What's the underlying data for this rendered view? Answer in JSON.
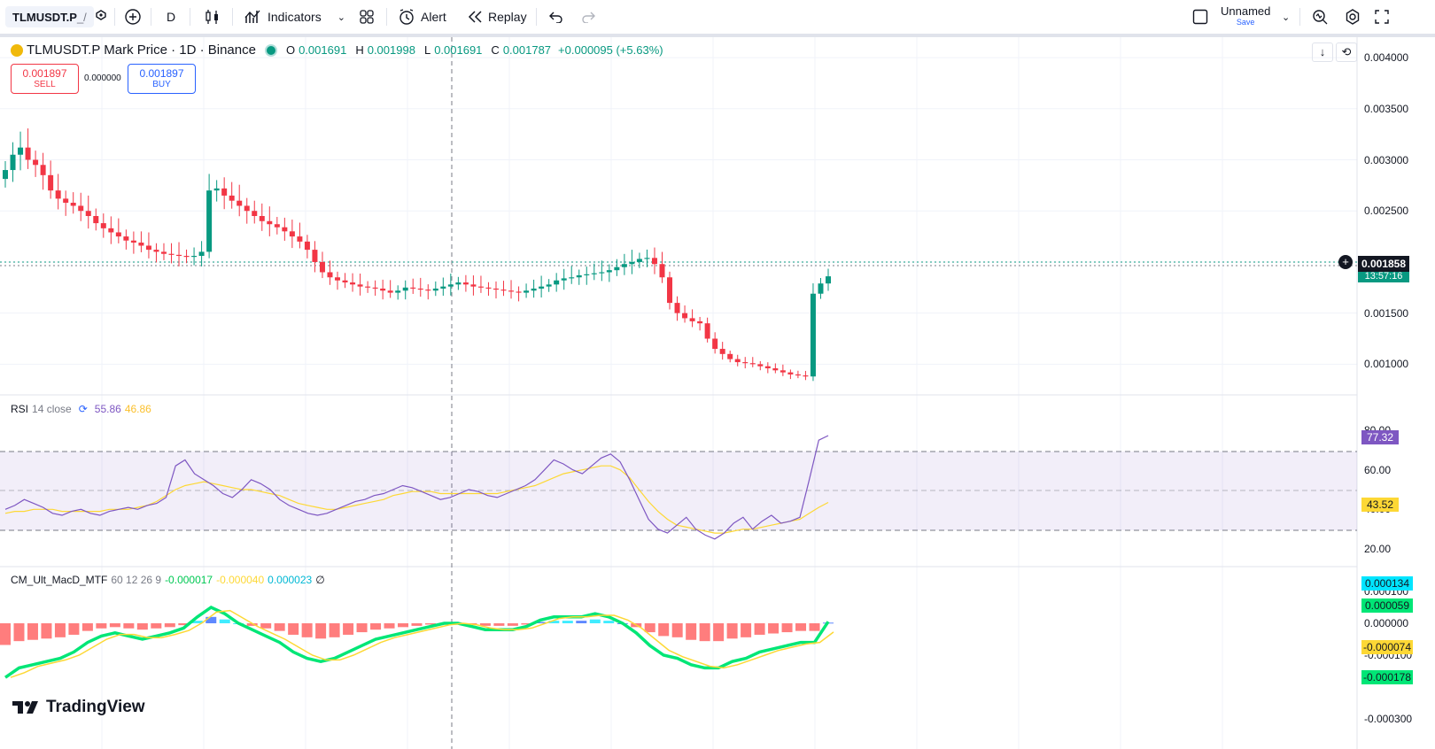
{
  "toolbar": {
    "symbol": "TLMUSDT.P",
    "interval": "D",
    "indicators_label": "Indicators",
    "alert_label": "Alert",
    "replay_label": "Replay",
    "layout_name": "Unnamed",
    "save_label": "Save"
  },
  "legend": {
    "title": "TLMUSDT.P Mark Price · 1D · Binance",
    "o_label": "O",
    "o_value": "0.001691",
    "h_label": "H",
    "h_value": "0.001998",
    "l_label": "L",
    "l_value": "0.001691",
    "c_label": "C",
    "c_value": "0.001787",
    "change": "+0.000095 (+5.63%)"
  },
  "trade": {
    "sell_price": "0.001897",
    "sell_label": "SELL",
    "spread": "0.000000",
    "buy_price": "0.001897",
    "buy_label": "BUY"
  },
  "price_axis": {
    "ticks": [
      "0.004000",
      "0.003500",
      "0.003000",
      "0.002500",
      "0.002000",
      "0.001500",
      "0.001000"
    ],
    "current_price": "0.001858",
    "countdown": "13:57:16"
  },
  "rsi": {
    "label": "RSI",
    "params": "14 close",
    "value": "55.86",
    "ma_value": "46.86",
    "ticks": [
      "80.00",
      "60.00",
      "40.00",
      "20.00"
    ],
    "current_pill": "77.32",
    "ma_pill": "43.52"
  },
  "macd": {
    "label": "CM_Ult_MacD_MTF",
    "params": "60 12 26 9",
    "v1": "-0.000017",
    "v2": "-0.000040",
    "v3": "0.000023",
    "v4": "∅",
    "ticks": [
      "0.000100",
      "0.000000",
      "-0.000100",
      "-0.000300"
    ],
    "pill_hist": "0.000134",
    "pill_signal": "0.000059",
    "pill_neg1": "-0.000074",
    "pill_neg2": "-0.000178"
  },
  "branding": "TradingView",
  "colors": {
    "up": "#089981",
    "down": "#f23645",
    "rsi": "#7e57c2",
    "rsi_ma": "#fdd835",
    "macd_up": "#00e676",
    "macd_down": "#ff5252",
    "hist_blue": "#2962ff",
    "hist_cyan": "#00e5ff"
  },
  "chart_data": {
    "type": "candlestick",
    "interval": "1D",
    "price_ylim": [
      0.0007,
      0.0042
    ],
    "closes": [
      0.0029,
      0.00305,
      0.00312,
      0.003,
      0.00295,
      0.00285,
      0.0027,
      0.00262,
      0.00258,
      0.00255,
      0.0025,
      0.00245,
      0.00238,
      0.00233,
      0.00229,
      0.00225,
      0.00221,
      0.00219,
      0.00216,
      0.00212,
      0.0021,
      0.00208,
      0.00207,
      0.00206,
      0.00205,
      0.00206,
      0.0021,
      0.0027,
      0.00272,
      0.00265,
      0.0026,
      0.00255,
      0.0025,
      0.00245,
      0.0024,
      0.00237,
      0.00234,
      0.0023,
      0.00225,
      0.0022,
      0.00212,
      0.002,
      0.0019,
      0.00185,
      0.00182,
      0.0018,
      0.00178,
      0.00176,
      0.00175,
      0.00174,
      0.00172,
      0.0017,
      0.00172,
      0.00175,
      0.00174,
      0.00173,
      0.00172,
      0.00174,
      0.00176,
      0.00178,
      0.0018,
      0.00178,
      0.00176,
      0.00175,
      0.00174,
      0.00173,
      0.00172,
      0.00171,
      0.0017,
      0.00172,
      0.00174,
      0.00176,
      0.00178,
      0.00182,
      0.00184,
      0.00185,
      0.00187,
      0.00188,
      0.00189,
      0.0019,
      0.00192,
      0.00195,
      0.00198,
      0.002,
      0.00203,
      0.00204,
      0.00198,
      0.00185,
      0.0016,
      0.0015,
      0.00145,
      0.00142,
      0.0014,
      0.00125,
      0.00115,
      0.0011,
      0.00105,
      0.00102,
      0.00101,
      0.001,
      0.00098,
      0.00096,
      0.00094,
      0.00092,
      0.0009,
      0.00089,
      0.00088,
      0.00169,
      0.00179,
      0.00186
    ],
    "rsi_values": [
      40,
      42,
      45,
      43,
      41,
      38,
      37,
      39,
      40,
      38,
      37,
      39,
      40,
      41,
      40,
      42,
      43,
      46,
      62,
      65,
      58,
      55,
      52,
      48,
      46,
      50,
      55,
      53,
      50,
      45,
      42,
      40,
      38,
      37,
      38,
      40,
      42,
      44,
      45,
      47,
      48,
      50,
      52,
      51,
      49,
      47,
      45,
      46,
      48,
      50,
      49,
      47,
      46,
      48,
      50,
      52,
      55,
      60,
      65,
      63,
      60,
      58,
      62,
      66,
      68,
      64,
      55,
      45,
      35,
      30,
      28,
      32,
      36,
      30,
      27,
      25,
      28,
      33,
      36,
      30,
      34,
      37,
      33,
      34,
      36,
      55,
      75,
      77.32
    ],
    "rsi_ma_values": [
      38,
      39,
      39,
      40,
      40,
      40,
      39,
      39,
      39,
      39,
      39,
      40,
      40,
      40,
      41,
      42,
      44,
      47,
      50,
      52,
      53,
      54,
      53,
      52,
      51,
      50,
      50,
      49,
      48,
      47,
      45,
      43,
      42,
      41,
      40,
      40,
      41,
      42,
      43,
      44,
      45,
      47,
      48,
      49,
      49,
      49,
      48,
      48,
      48,
      48,
      48,
      48,
      48,
      49,
      50,
      51,
      52,
      54,
      56,
      58,
      59,
      60,
      61,
      62,
      62,
      60,
      56,
      50,
      44,
      39,
      35,
      32,
      31,
      30,
      29,
      28,
      28,
      29,
      30,
      30,
      31,
      32,
      33,
      34,
      35,
      38,
      41,
      43.52
    ],
    "rsi_bands": [
      70,
      50,
      30
    ],
    "macd_values": [
      -0.00017,
      -0.00014,
      -0.00013,
      -0.00012,
      -0.00011,
      -9e-05,
      -6e-05,
      -4e-05,
      -3e-05,
      -4e-05,
      -5e-05,
      -4e-05,
      -3e-05,
      -1.5e-05,
      2e-05,
      5e-05,
      3e-05,
      0.0,
      -2e-05,
      -4e-05,
      -6e-05,
      -9e-05,
      -0.00011,
      -0.00012,
      -0.00011,
      -9e-05,
      -7e-05,
      -5e-05,
      -4e-05,
      -3e-05,
      -2e-05,
      -1e-05,
      0.0,
      0.0,
      -1e-05,
      -2e-05,
      -2e-05,
      -2e-05,
      -1e-05,
      1e-05,
      2e-05,
      2e-05,
      2e-05,
      3e-05,
      2e-05,
      0.0,
      -3e-05,
      -7e-05,
      -0.0001,
      -0.00011,
      -0.00013,
      -0.00014,
      -0.00014,
      -0.00012,
      -0.00011,
      -9e-05,
      -8e-05,
      -7e-05,
      -6e-05,
      -6e-05,
      5e-06
    ],
    "title": "TLMUSDT.P Mark Price · 1D · Binance"
  }
}
